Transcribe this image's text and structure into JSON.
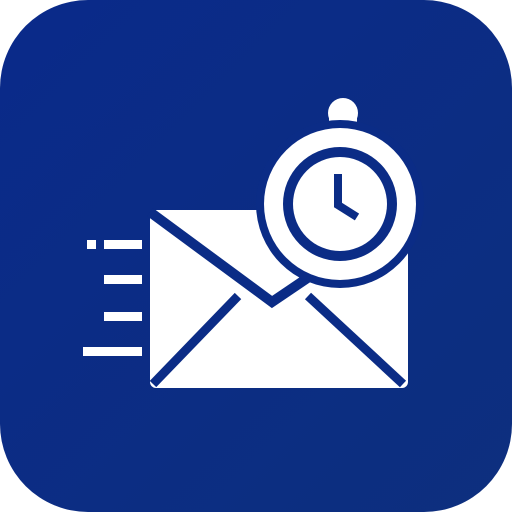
{
  "icon": {
    "name": "timed-email-app-icon",
    "symbols": [
      "fast-mail-envelope-icon",
      "stopwatch-icon",
      "speed-lines-icon"
    ],
    "colors": {
      "background_top": "#0a2a8a",
      "background_bottom": "#0d2f7e",
      "glyph": "#ffffff"
    }
  }
}
